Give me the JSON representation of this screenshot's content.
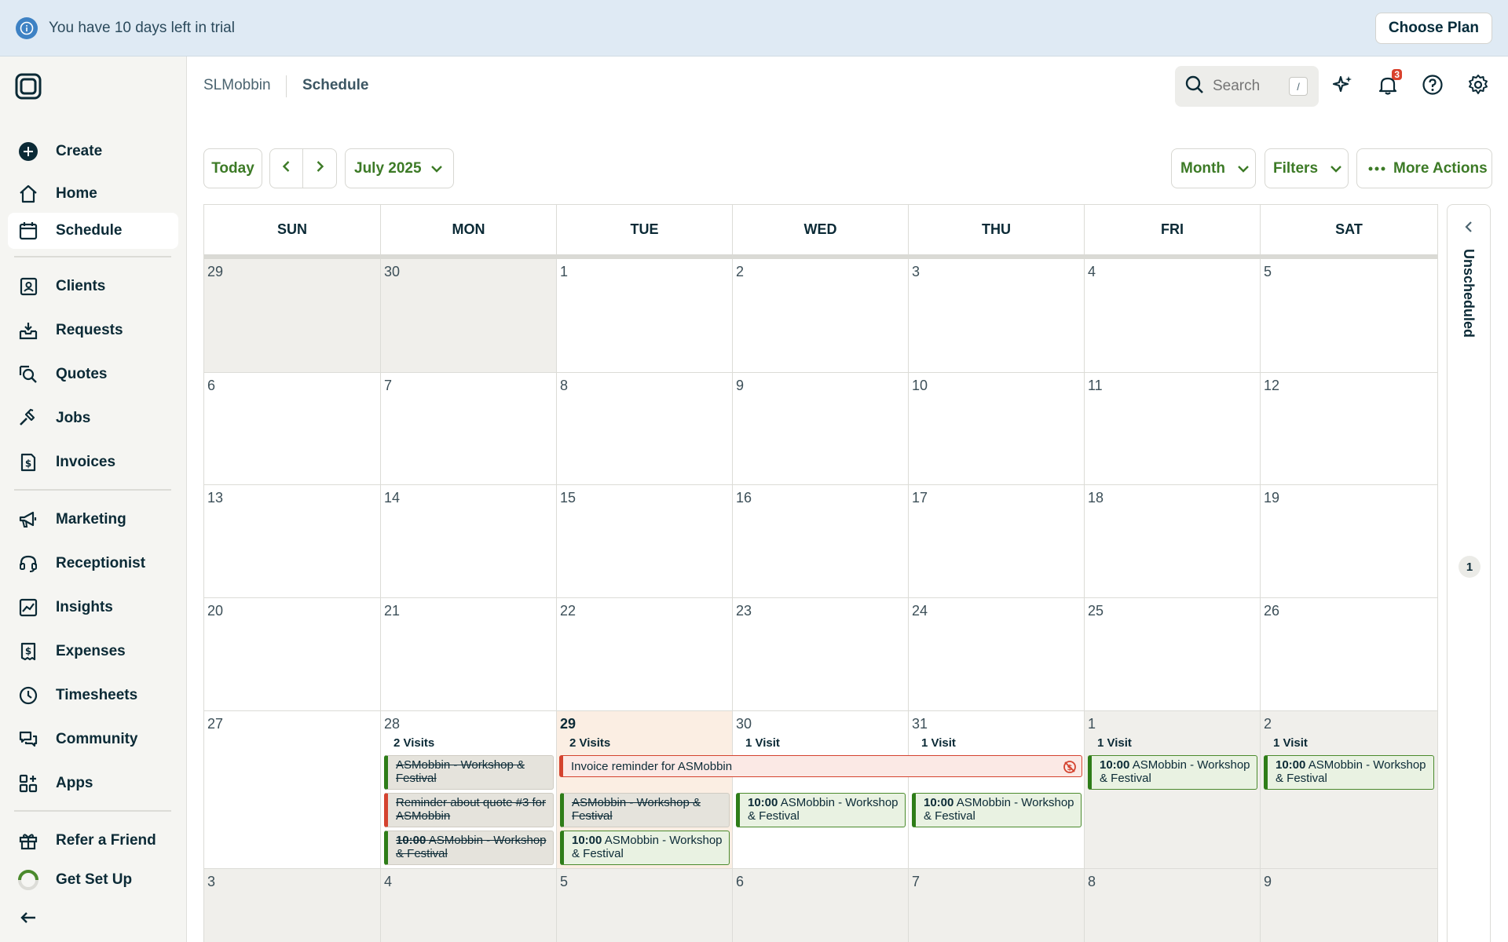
{
  "banner": {
    "message": "You have 10 days left in trial",
    "choose_plan": "Choose Plan"
  },
  "sidebar": {
    "items": [
      {
        "label": "Create",
        "icon": "plus-circle-icon"
      },
      {
        "label": "Home",
        "icon": "home-icon"
      },
      {
        "label": "Schedule",
        "icon": "calendar-icon",
        "active": true
      },
      {
        "label": "Clients",
        "icon": "address-book-icon"
      },
      {
        "label": "Requests",
        "icon": "inbox-download-icon"
      },
      {
        "label": "Quotes",
        "icon": "quote-search-icon"
      },
      {
        "label": "Jobs",
        "icon": "hammer-icon"
      },
      {
        "label": "Invoices",
        "icon": "invoice-dollar-icon"
      },
      {
        "label": "Marketing",
        "icon": "megaphone-icon"
      },
      {
        "label": "Receptionist",
        "icon": "headset-icon"
      },
      {
        "label": "Insights",
        "icon": "chart-icon"
      },
      {
        "label": "Expenses",
        "icon": "receipt-dollar-icon"
      },
      {
        "label": "Timesheets",
        "icon": "clock-icon"
      },
      {
        "label": "Community",
        "icon": "chat-bubbles-icon"
      },
      {
        "label": "Apps",
        "icon": "apps-grid-icon"
      },
      {
        "label": "Refer a Friend",
        "icon": "gift-icon"
      },
      {
        "label": "Get Set Up",
        "icon": "progress-ring-icon"
      }
    ]
  },
  "header": {
    "breadcrumb_company": "SLMobbin",
    "breadcrumb_page": "Schedule",
    "search_placeholder": "Search",
    "search_shortcut": "/",
    "notification_count": "3"
  },
  "toolbar": {
    "today": "Today",
    "month_picker": "July 2025",
    "view": "Month",
    "filters": "Filters",
    "more_actions": "More Actions"
  },
  "calendar": {
    "weekdays": [
      "SUN",
      "MON",
      "TUE",
      "WED",
      "THU",
      "FRI",
      "SAT"
    ],
    "weeks": [
      [
        "29",
        "30",
        "1",
        "2",
        "3",
        "4",
        "5"
      ],
      [
        "6",
        "7",
        "8",
        "9",
        "10",
        "11",
        "12"
      ],
      [
        "13",
        "14",
        "15",
        "16",
        "17",
        "18",
        "19"
      ],
      [
        "20",
        "21",
        "22",
        "23",
        "24",
        "25",
        "26"
      ],
      [
        "27",
        "28",
        "29",
        "30",
        "31",
        "1",
        "2"
      ],
      [
        "3",
        "4",
        "5",
        "6",
        "7",
        "8",
        "9"
      ]
    ],
    "visit_counts": {
      "mon28": "2 Visits",
      "tue29": "2 Visits",
      "wed30": "1 Visit",
      "thu31": "1 Visit",
      "fri1": "1 Visit",
      "sat2": "1 Visit"
    },
    "events": {
      "mon28_a": "ASMobbin - Workshop & Festival",
      "mon28_b": "Reminder about quote #3 for ASMobbin",
      "mon28_c_time": "10:00",
      "mon28_c_title": "ASMobbin - Workshop & Festival",
      "invoice_reminder": "Invoice reminder for ASMobbin",
      "tue29_a": "ASMobbin - Workshop & Festival",
      "tue29_b_time": "10:00",
      "tue29_b_title": "ASMobbin - Workshop & Festival",
      "wed30_time": "10:00",
      "wed30_title": "ASMobbin - Workshop & Festival",
      "thu31_time": "10:00",
      "thu31_title": "ASMobbin - Workshop & Festival",
      "fri1_time": "10:00",
      "fri1_title": "ASMobbin - Workshop & Festival",
      "sat2_time": "10:00",
      "sat2_title": "ASMobbin - Workshop & Festival"
    }
  },
  "unscheduled": {
    "label": "Unscheduled",
    "count": "1"
  },
  "colors": {
    "accent_green": "#3c7a26",
    "banner_bg": "#dfeaf4",
    "today_bg": "#fbeee3",
    "reminder_red": "#d4432f",
    "badge_red": "#d9412d"
  }
}
